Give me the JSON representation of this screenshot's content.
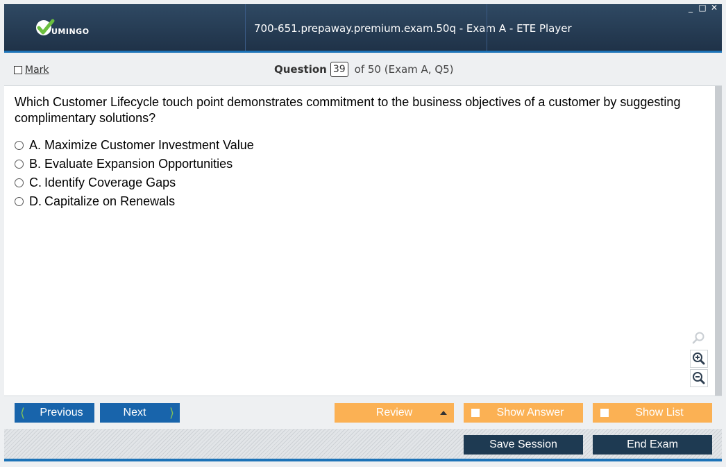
{
  "app": {
    "logo_text": "UMINGO",
    "window_title": "700-651.prepaway.premium.exam.50q - Exam A - ETE Player",
    "controls": {
      "minimize": "_",
      "maximize": "□",
      "close": "✕"
    }
  },
  "header": {
    "mark_label": "Mark",
    "question_label": "Question",
    "question_number": "39",
    "question_of": "of 50 (Exam A, Q5)"
  },
  "question": {
    "text": "Which Customer Lifecycle touch point demonstrates commitment to the business objectives of a customer by suggesting complimentary solutions?",
    "options": [
      {
        "letter": "A.",
        "text": "Maximize Customer Investment Value"
      },
      {
        "letter": "B.",
        "text": "Evaluate Expansion Opportunities"
      },
      {
        "letter": "C.",
        "text": "Identify Coverage Gaps"
      },
      {
        "letter": "D.",
        "text": "Capitalize on Renewals"
      }
    ]
  },
  "nav": {
    "previous": "Previous",
    "next": "Next",
    "review": "Review",
    "show_answer": "Show Answer",
    "show_list": "Show List"
  },
  "footer": {
    "save_session": "Save Session",
    "end_exam": "End Exam"
  },
  "colors": {
    "titlebar": "#2f4963",
    "accent_blue": "#1864ab",
    "orange": "#fbb154",
    "dark_button": "#1e3a52",
    "logo_green": "#6cbf3f"
  },
  "icons": [
    "check-logo-icon",
    "search-icon",
    "zoom-in-icon",
    "zoom-out-icon",
    "chevron-left-icon",
    "chevron-right-icon",
    "triangle-up-icon"
  ]
}
